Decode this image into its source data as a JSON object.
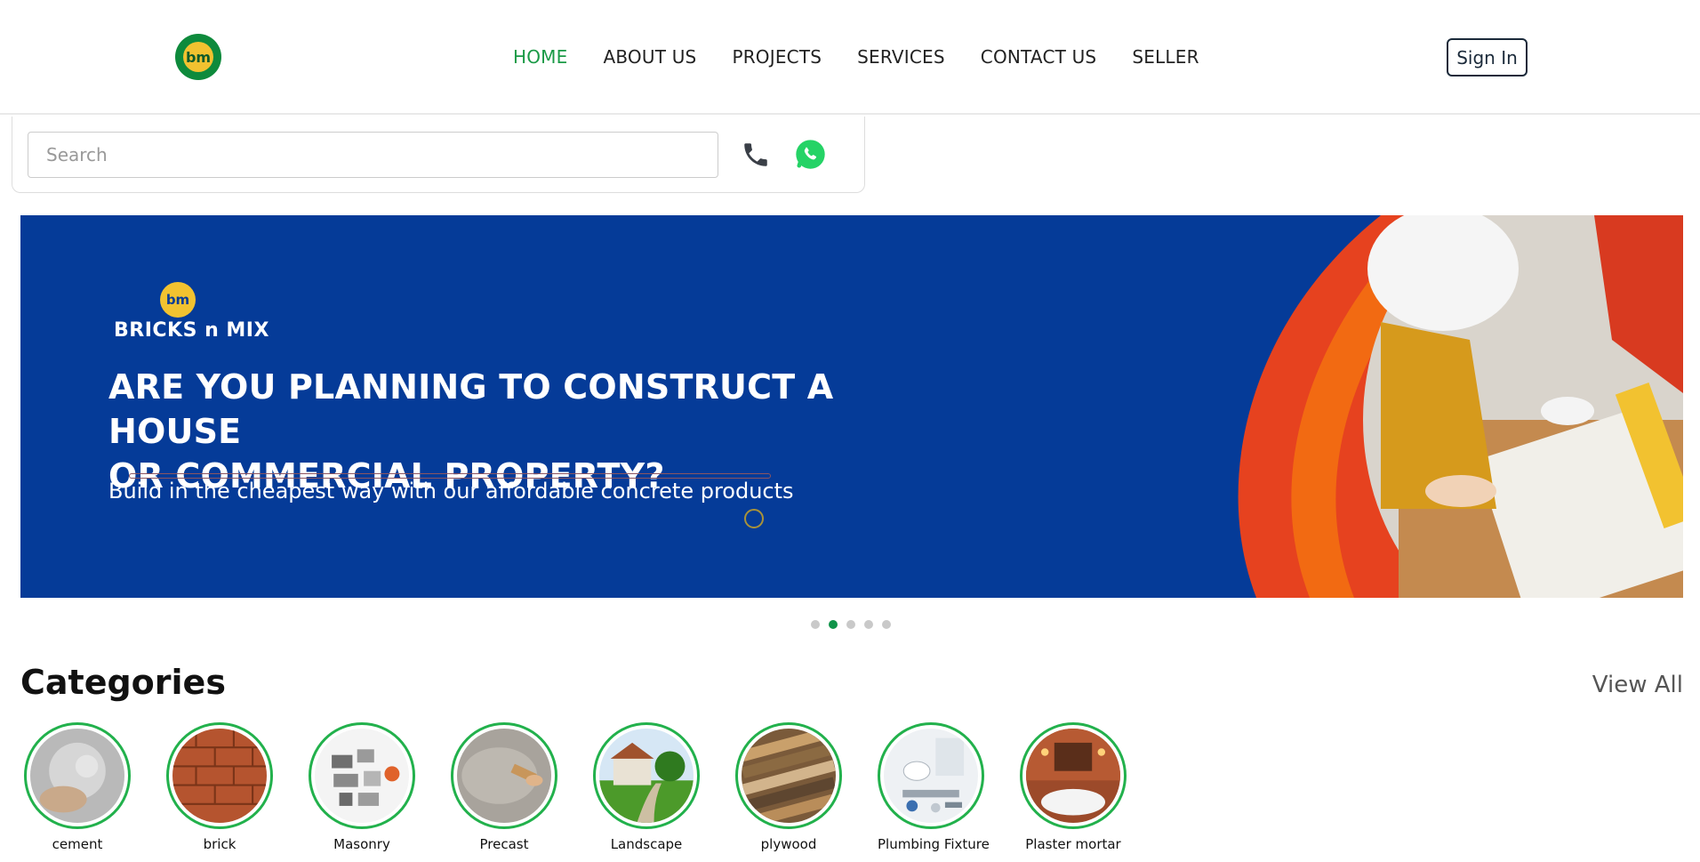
{
  "header": {
    "logo_text": "bm",
    "nav": [
      {
        "label": "HOME",
        "active": true
      },
      {
        "label": "ABOUT US",
        "active": false
      },
      {
        "label": "PROJECTS",
        "active": false
      },
      {
        "label": "SERVICES",
        "active": false
      },
      {
        "label": "CONTACT US",
        "active": false
      },
      {
        "label": "SELLER",
        "active": false
      }
    ],
    "signin_label": "Sign In",
    "accent_color": "#1a9a46"
  },
  "search": {
    "placeholder": "Search",
    "value": "",
    "phone_icon": "phone-icon",
    "whatsapp_icon": "whatsapp-icon"
  },
  "banner": {
    "brand": "BRICKS n MIX",
    "headline_line1": "ARE YOU PLANNING TO CONSTRUCT A HOUSE",
    "headline_line2": "OR COMMERCIAL PROPERTY?",
    "subtitle": "Build in the cheapest way with our affordable concrete products",
    "background_color": "#053b98",
    "slide_count": 5,
    "active_slide": 2
  },
  "categories": {
    "title": "Categories",
    "view_all_label": "View All",
    "items": [
      {
        "label": "cement"
      },
      {
        "label": "brick"
      },
      {
        "label": "Masonry"
      },
      {
        "label": "Precast"
      },
      {
        "label": "Landscape"
      },
      {
        "label": "plywood"
      },
      {
        "label": "Plumbing Fixture"
      },
      {
        "label": "Plaster mortar"
      }
    ]
  }
}
